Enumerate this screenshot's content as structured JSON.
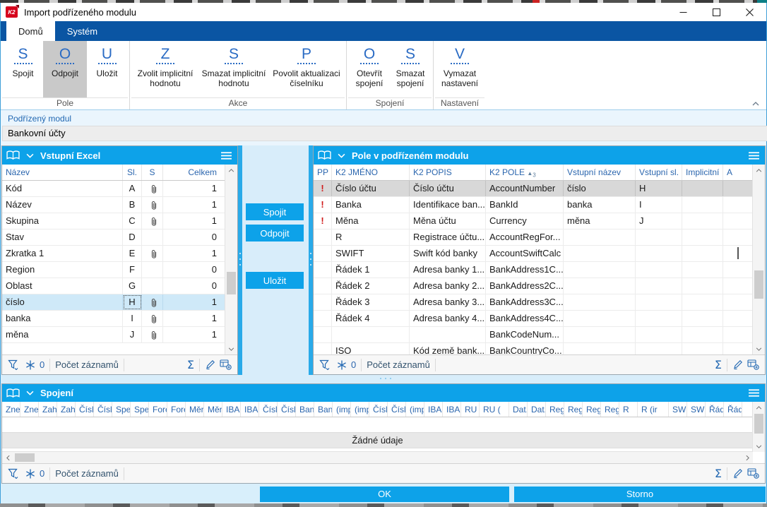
{
  "window": {
    "title": "Import podřízeného modulu",
    "logo_text": "K2"
  },
  "ribbon": {
    "tabs": [
      {
        "label": "Domů",
        "active": true
      },
      {
        "label": "Systém",
        "active": false
      }
    ],
    "groups": [
      {
        "label": "Pole",
        "buttons": [
          {
            "letter": "S",
            "label": "Spojit",
            "pressed": false
          },
          {
            "letter": "O",
            "label": "Odpojit",
            "pressed": true
          },
          {
            "letter": "U",
            "label": "Uložit",
            "pressed": false
          }
        ]
      },
      {
        "label": "Akce",
        "buttons": [
          {
            "letter": "Z",
            "label": "Zvolit implicitní hodnotu",
            "pressed": false
          },
          {
            "letter": "S",
            "label": "Smazat implicitní hodnotu",
            "pressed": false
          },
          {
            "letter": "P",
            "label": "Povolit aktualizaci číselníku",
            "pressed": false
          }
        ]
      },
      {
        "label": "Spojení",
        "buttons": [
          {
            "letter": "O",
            "label": "Otevřít spojení",
            "pressed": false
          },
          {
            "letter": "S",
            "label": "Smazat spojení",
            "pressed": false
          }
        ]
      },
      {
        "label": "Nastavení",
        "buttons": [
          {
            "letter": "V",
            "label": "Vymazat nastavení",
            "pressed": false
          }
        ]
      }
    ]
  },
  "module": {
    "label": "Podřízený modul",
    "value": "Bankovní účty"
  },
  "left_panel": {
    "title": "Vstupní Excel",
    "columns": [
      "Název",
      "Sl.",
      "S",
      "Celkem"
    ],
    "rows": [
      {
        "nazev": "Kód",
        "sl": "A",
        "clip": true,
        "celkem": "1",
        "selected": false
      },
      {
        "nazev": "Název",
        "sl": "B",
        "clip": true,
        "celkem": "1",
        "selected": false
      },
      {
        "nazev": "Skupina",
        "sl": "C",
        "clip": true,
        "celkem": "1",
        "selected": false
      },
      {
        "nazev": "Stav",
        "sl": "D",
        "clip": false,
        "celkem": "0",
        "selected": false
      },
      {
        "nazev": "Zkratka 1",
        "sl": "E",
        "clip": true,
        "celkem": "1",
        "selected": false
      },
      {
        "nazev": "Region",
        "sl": "F",
        "clip": false,
        "celkem": "0",
        "selected": false
      },
      {
        "nazev": "Oblast",
        "sl": "G",
        "clip": false,
        "celkem": "0",
        "selected": false
      },
      {
        "nazev": "číslo",
        "sl": "H",
        "clip": true,
        "celkem": "1",
        "selected": true
      },
      {
        "nazev": "banka",
        "sl": "I",
        "clip": true,
        "celkem": "1",
        "selected": false
      },
      {
        "nazev": "měna",
        "sl": "J",
        "clip": true,
        "celkem": "1",
        "selected": false
      }
    ],
    "status": {
      "freeze_count": "0",
      "records_label": "Počet záznamů"
    }
  },
  "link_buttons": {
    "spojit": "Spojit",
    "odpojit": "Odpojit",
    "ulozit": "Uložit"
  },
  "right_panel": {
    "title": "Pole v podřízeném modulu",
    "columns": [
      "PP",
      "K2 JMÉNO",
      "K2 POPIS",
      "K2 POLE",
      "Vstupní název",
      "Vstupní sl.",
      "Implicitní",
      "A"
    ],
    "sort_column": "K2 POLE",
    "sort_icon": "▲",
    "sort_order": "3",
    "rows": [
      {
        "pp": "!",
        "jmeno": "Číslo účtu",
        "popis": "Číslo účtu",
        "pole": "AccountNumber",
        "vstupni_nazev": "číslo",
        "vstupni_sl": "H",
        "implicitni": "",
        "a": "",
        "selected": true,
        "checkbox": false
      },
      {
        "pp": "!",
        "jmeno": "Banka",
        "popis": "Identifikace ban...",
        "pole": "BankId",
        "vstupni_nazev": "banka",
        "vstupni_sl": "I",
        "implicitni": "",
        "a": "",
        "selected": false,
        "checkbox": false
      },
      {
        "pp": "!",
        "jmeno": "Měna",
        "popis": "Měna účtu",
        "pole": "Currency",
        "vstupni_nazev": "měna",
        "vstupni_sl": "J",
        "implicitni": "",
        "a": "",
        "selected": false,
        "checkbox": false
      },
      {
        "pp": "",
        "jmeno": "R",
        "popis": "Registrace účtu...",
        "pole": "AccountRegFor...",
        "vstupni_nazev": "",
        "vstupni_sl": "",
        "implicitni": "",
        "a": "",
        "selected": false,
        "checkbox": false
      },
      {
        "pp": "",
        "jmeno": "SWIFT",
        "popis": "Swift kód banky",
        "pole": "AccountSwiftCalc",
        "vstupni_nazev": "",
        "vstupni_sl": "",
        "implicitni": "",
        "a": "",
        "selected": false,
        "checkbox": true
      },
      {
        "pp": "",
        "jmeno": "Řádek 1",
        "popis": "Adresa banky 1...",
        "pole": "BankAddress1C...",
        "vstupni_nazev": "",
        "vstupni_sl": "",
        "implicitni": "",
        "a": "",
        "selected": false,
        "checkbox": false
      },
      {
        "pp": "",
        "jmeno": "Řádek 2",
        "popis": "Adresa banky 2...",
        "pole": "BankAddress2C...",
        "vstupni_nazev": "",
        "vstupni_sl": "",
        "implicitni": "",
        "a": "",
        "selected": false,
        "checkbox": false
      },
      {
        "pp": "",
        "jmeno": "Řádek 3",
        "popis": "Adresa banky 3...",
        "pole": "BankAddress3C...",
        "vstupni_nazev": "",
        "vstupni_sl": "",
        "implicitni": "",
        "a": "",
        "selected": false,
        "checkbox": false
      },
      {
        "pp": "",
        "jmeno": "Řádek 4",
        "popis": "Adresa banky 4...",
        "pole": "BankAddress4C...",
        "vstupni_nazev": "",
        "vstupni_sl": "",
        "implicitni": "",
        "a": "",
        "selected": false,
        "checkbox": false
      },
      {
        "pp": "",
        "jmeno": "",
        "popis": "",
        "pole": "BankCodeNum...",
        "vstupni_nazev": "",
        "vstupni_sl": "",
        "implicitni": "",
        "a": "",
        "selected": false,
        "checkbox": false
      },
      {
        "pp": "",
        "jmeno": "ISO",
        "popis": "Kód země bank...",
        "pole": "BankCountryCo...",
        "vstupni_nazev": "",
        "vstupni_sl": "",
        "implicitni": "",
        "a": "",
        "selected": false,
        "checkbox": false
      }
    ],
    "status": {
      "freeze_count": "0",
      "records_label": "Počet záznamů"
    }
  },
  "bottom_panel": {
    "title": "Spojení",
    "columns": [
      "Zne",
      "Zne",
      "Zah",
      "Zah",
      "Čísl",
      "Čísl",
      "Spe",
      "Spe",
      "Fore",
      "Fore",
      "Měr",
      "Měr",
      "IBAN",
      "IBAN",
      "Čísl",
      "Čísl",
      "Banl",
      "Banl",
      "(imp",
      "(imp",
      "Čísl",
      "Čísl",
      "(imp",
      "IBAN",
      "IBAN",
      "RU",
      "RU (",
      "Dat.",
      "Dat.",
      "Regi",
      "Regi",
      "Regi",
      "Regi",
      "R",
      "R (ir",
      "SWII",
      "SWII",
      "Řád",
      "Řád"
    ],
    "empty_text": "Žádné údaje",
    "status": {
      "freeze_count": "0",
      "records_label": "Počet záznamů"
    }
  },
  "footer": {
    "ok": "OK",
    "cancel": "Storno"
  },
  "icons": {
    "sum": "Σ",
    "sort_asc": "▲"
  },
  "colors": {
    "accent_blue": "#0da2e9",
    "ribbon_blue": "#0a55a3",
    "selection_blue": "#cfe9f8",
    "selection_grey": "#d8d8d8",
    "alert_red": "#d01b1b",
    "header_text_blue": "#2b66ae"
  }
}
